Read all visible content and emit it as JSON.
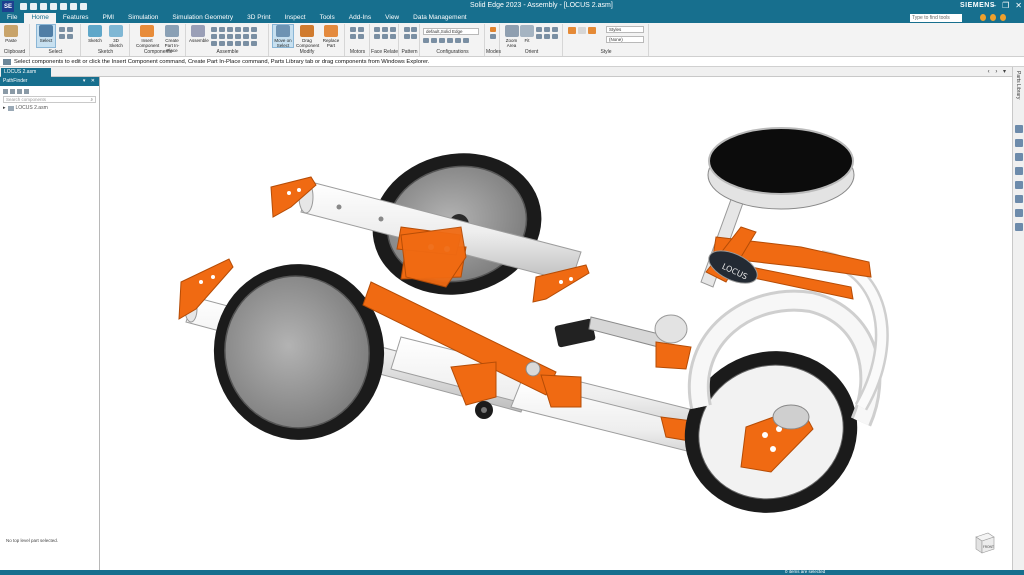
{
  "app": {
    "icon_label": "SE",
    "window_title": "Solid Edge 2023 - Assembly - [LOCUS 2.asm]",
    "brand": "SIEMENS",
    "window_controls": [
      "–",
      "❐",
      "✕"
    ]
  },
  "menu": {
    "tabs": [
      "File",
      "Home",
      "Features",
      "PMI",
      "Simulation",
      "Simulation Geometry",
      "3D Print",
      "Inspect",
      "Tools",
      "Add-Ins",
      "View",
      "Data Management"
    ],
    "active_tab": "Home",
    "search_placeholder": "Type to find tools"
  },
  "ribbon": {
    "groups": [
      {
        "label": "Clipboard",
        "button": "Paste"
      },
      {
        "label": "Select",
        "button": "Select"
      },
      {
        "label": "Sketch",
        "button": "Sketch",
        "button2": "3D Sketch"
      },
      {
        "label": "Components",
        "button": "Insert Component",
        "button2": "Create Part In-Place"
      },
      {
        "label": "Assemble",
        "button": "Assemble"
      },
      {
        "label": "Modify",
        "button": "Move on Select",
        "button2": "Drag Component",
        "button3": "Replace Part"
      },
      {
        "label": "Motors"
      },
      {
        "label": "Face Relate"
      },
      {
        "label": "Pattern"
      },
      {
        "label": "Configurations",
        "combo": "default,Solid Edge"
      },
      {
        "label": "Modes"
      },
      {
        "label": "Orient",
        "button": "Zoom Area",
        "button2": "Fit"
      },
      {
        "label": "Style",
        "combo": "Styles",
        "combo2": "(None)"
      }
    ]
  },
  "prompt": {
    "text": "Select components to edit or click the Insert Component command, Create Part In-Place command, Parts Library tab or drag components from Windows Explorer."
  },
  "document": {
    "tab_label": "LOCUS 2.asm"
  },
  "pathfinder": {
    "title": "PathFinder",
    "search_placeholder": "Search components",
    "tree": [
      {
        "label": "LOCUS 2.asm"
      }
    ],
    "status": "No top level part selected."
  },
  "side_panel": {
    "label": "Parts Library"
  },
  "viewport": {
    "seat_label": "LOCUS",
    "view_cube_label": "FRONT",
    "colors": {
      "frame": "#f7f7f7",
      "bracket": "#f06a12",
      "tire": "#1b1b1b",
      "hub": "#8e8e8e"
    }
  },
  "statusbar": {
    "text": "0 items are selected"
  }
}
